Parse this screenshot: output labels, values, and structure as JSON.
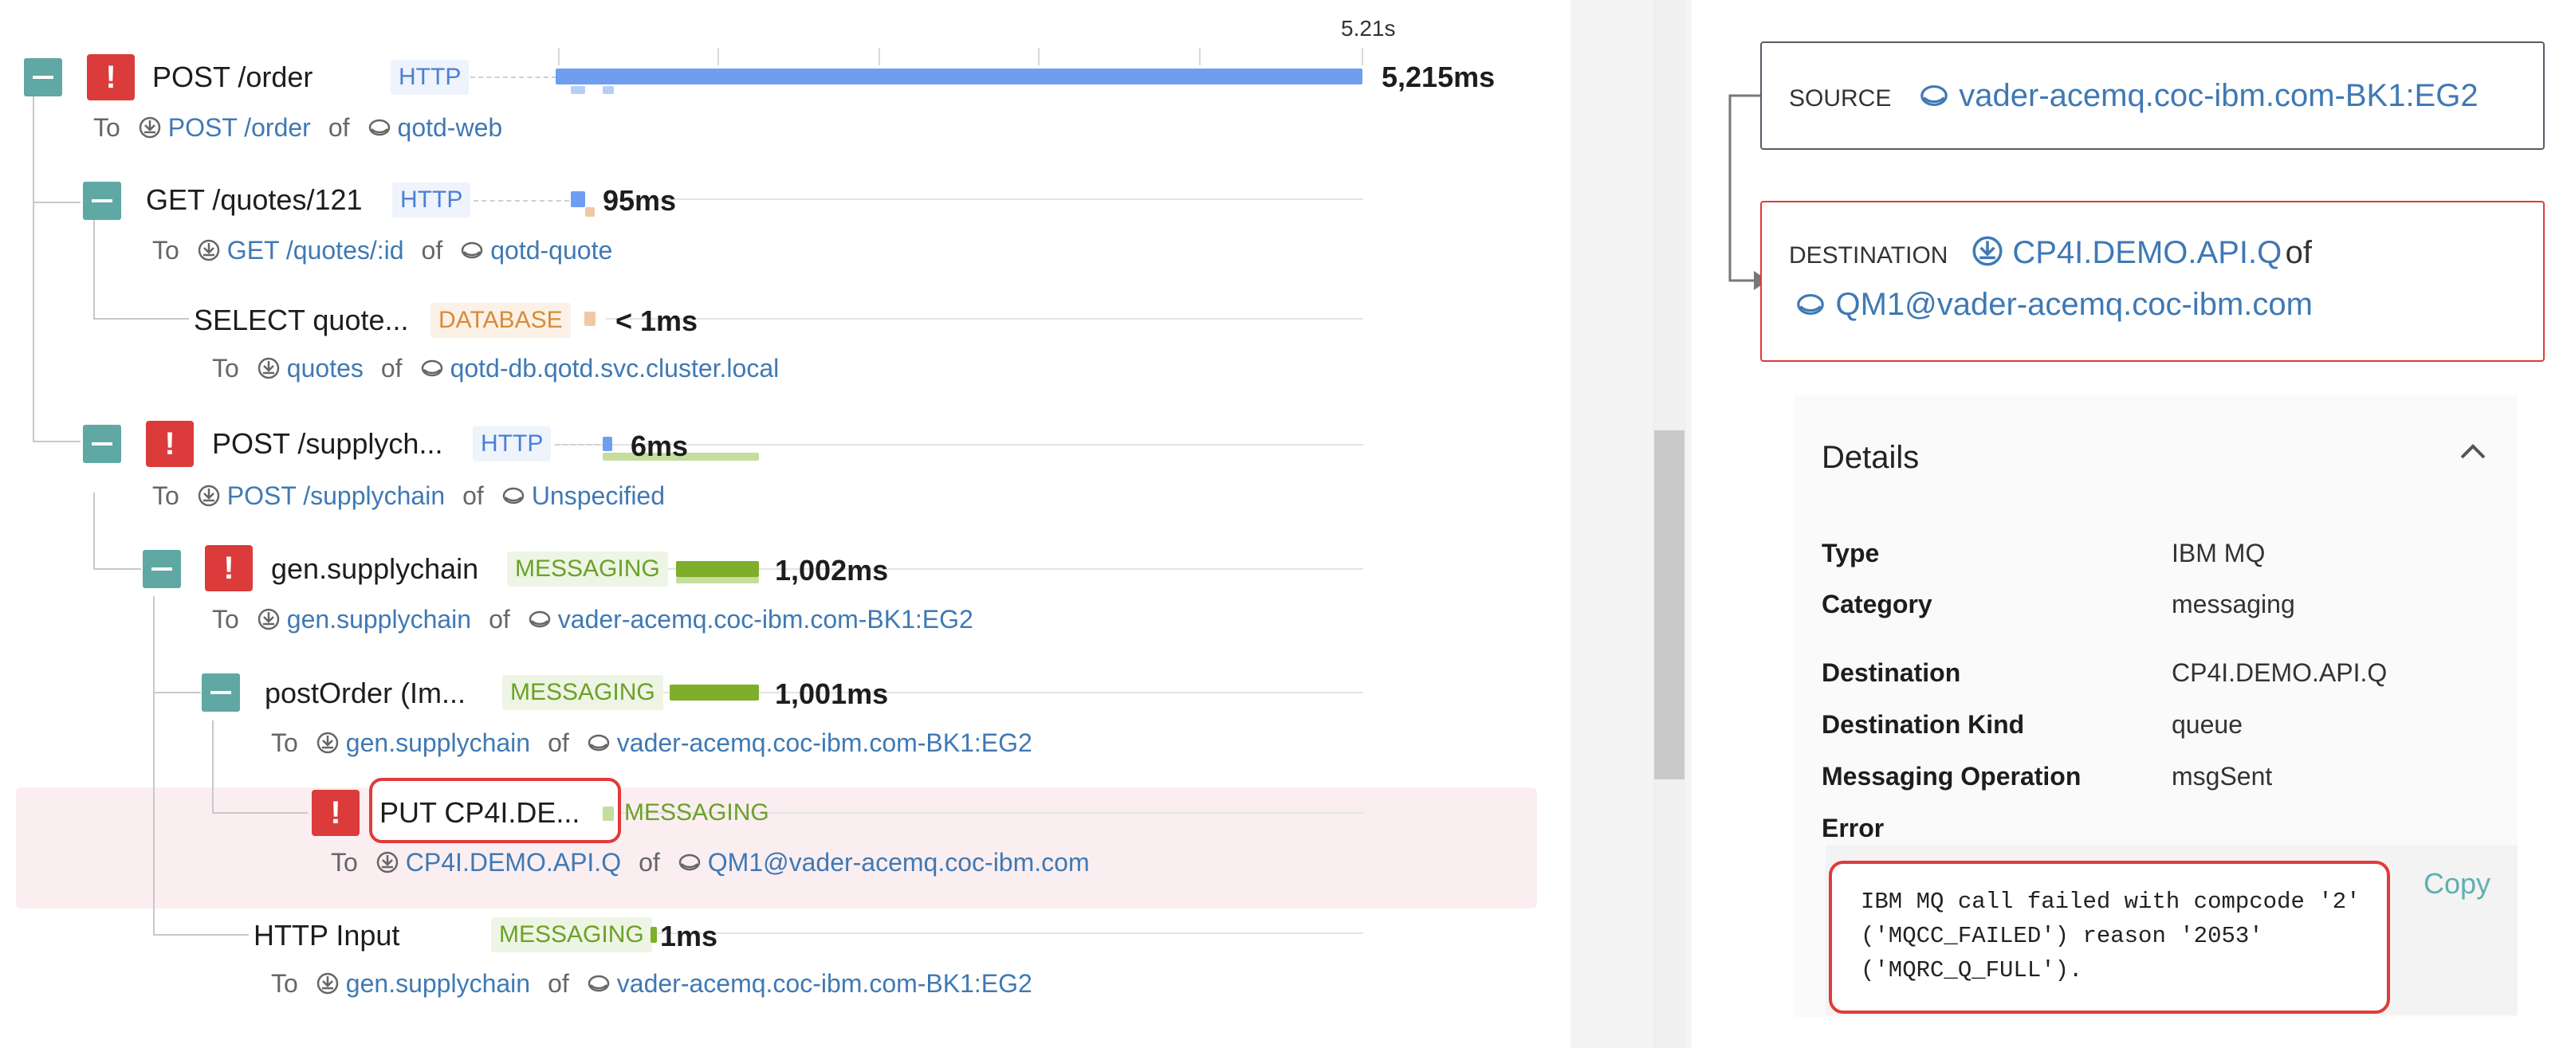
{
  "timeline": {
    "total_label": "5.21s"
  },
  "spans": [
    {
      "name": "POST /order",
      "tag": "HTTP",
      "duration": "5,215ms",
      "to_label": "To",
      "endpoint": "POST /order",
      "of_label": "of",
      "service": "qotd-web"
    },
    {
      "name": "GET /quotes/121",
      "tag": "HTTP",
      "duration": "95ms",
      "to_label": "To",
      "endpoint": "GET /quotes/:id",
      "of_label": "of",
      "service": "qotd-quote"
    },
    {
      "name": "SELECT quote...",
      "tag": "DATABASE",
      "duration": "< 1ms",
      "to_label": "To",
      "endpoint": "quotes",
      "of_label": "of",
      "service": "qotd-db.qotd.svc.cluster.local"
    },
    {
      "name": "POST /supplych...",
      "tag": "HTTP",
      "duration": "6ms",
      "to_label": "To",
      "endpoint": "POST /supplychain",
      "of_label": "of",
      "service": "Unspecified"
    },
    {
      "name": "gen.supplychain",
      "tag": "MESSAGING",
      "duration": "1,002ms",
      "to_label": "To",
      "endpoint": "gen.supplychain",
      "of_label": "of",
      "service": "vader-acemq.coc-ibm.com-BK1:EG2"
    },
    {
      "name": "postOrder (Im...",
      "tag": "MESSAGING",
      "duration": "1,001ms",
      "to_label": "To",
      "endpoint": "gen.supplychain",
      "of_label": "of",
      "service": "vader-acemq.coc-ibm.com-BK1:EG2"
    },
    {
      "name": "PUT CP4I.DE...",
      "tag": "MESSAGING",
      "duration": "",
      "to_label": "To",
      "endpoint": "CP4I.DEMO.API.Q",
      "of_label": "of",
      "service": "QM1@vader-acemq.coc-ibm.com"
    },
    {
      "name": "HTTP Input",
      "tag": "MESSAGING",
      "duration": "1ms",
      "to_label": "To",
      "endpoint": "gen.supplychain",
      "of_label": "of",
      "service": "vader-acemq.coc-ibm.com-BK1:EG2"
    }
  ],
  "source": {
    "label": "SOURCE",
    "value": "vader-acemq.coc-ibm.com-BK1:EG2"
  },
  "destination": {
    "label": "DESTINATION",
    "queue": "CP4I.DEMO.API.Q",
    "of_label": "of",
    "manager": "QM1@vader-acemq.coc-ibm.com"
  },
  "details": {
    "title": "Details",
    "rows": [
      {
        "key": "Type",
        "value": "IBM MQ"
      },
      {
        "key": "Category",
        "value": "messaging"
      },
      {
        "key": "Destination",
        "value": "CP4I.DEMO.API.Q"
      },
      {
        "key": "Destination Kind",
        "value": "queue"
      },
      {
        "key": "Messaging Operation",
        "value": "msgSent"
      }
    ],
    "error_label": "Error",
    "error_text": "IBM MQ call failed with compcode '2'\n('MQCC_FAILED') reason '2053'\n('MQRC_Q_FULL').",
    "copy_label": "Copy"
  },
  "colors": {
    "http": "#6f9ef0",
    "messaging": "#7fae2a",
    "database": "#f0c9a3",
    "error": "#db3b3b",
    "selected_row": "#fbeef1",
    "link": "#3f79b4",
    "collapse": "#5fa8a3"
  }
}
